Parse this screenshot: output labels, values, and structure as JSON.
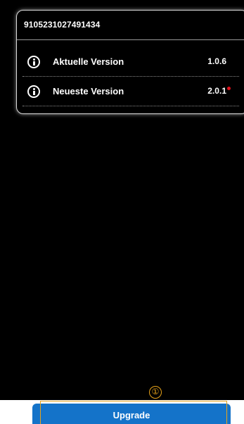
{
  "device": {
    "serial": "9105231027491434"
  },
  "versions": [
    {
      "icon": "info-icon",
      "label": "Aktuelle Version",
      "value": "1.0.6"
    },
    {
      "icon": "info-icon",
      "label": "Neueste Version",
      "value": "2.0.1",
      "update_indicator_color": "#e0111b"
    }
  ],
  "annotation": {
    "marker": "①",
    "color": "#e8a31a"
  },
  "actions": {
    "upgrade_label": "Upgrade",
    "upgrade_color": "#1473c9"
  }
}
